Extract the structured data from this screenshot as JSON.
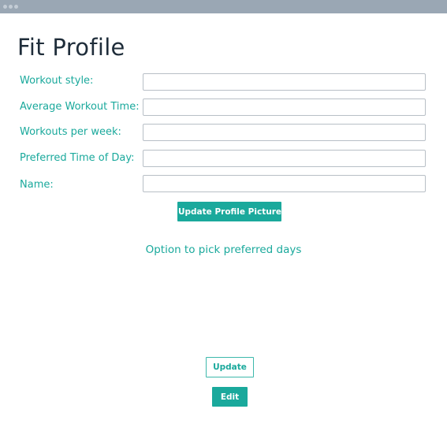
{
  "window": {
    "titlebar_color": "#9aa7b4"
  },
  "page": {
    "title": "Fit Profile"
  },
  "form": {
    "fields": [
      {
        "label": "Workout style:",
        "value": "",
        "placeholder": ""
      },
      {
        "label": "Average Workout Time:",
        "value": "",
        "placeholder": ""
      },
      {
        "label": "Workouts per week:",
        "value": "",
        "placeholder": ""
      },
      {
        "label": "Preferred Time of Day:",
        "value": "",
        "placeholder": ""
      },
      {
        "label": "Name:",
        "value": "",
        "placeholder": ""
      }
    ]
  },
  "buttons": {
    "update_picture": "Update Profile Picture",
    "update": "Update",
    "edit": "Edit"
  },
  "note": "Option to pick preferred days",
  "colors": {
    "accent": "#1aa99c",
    "title_text": "#1f2d3a",
    "input_border": "#b8bfc6"
  }
}
